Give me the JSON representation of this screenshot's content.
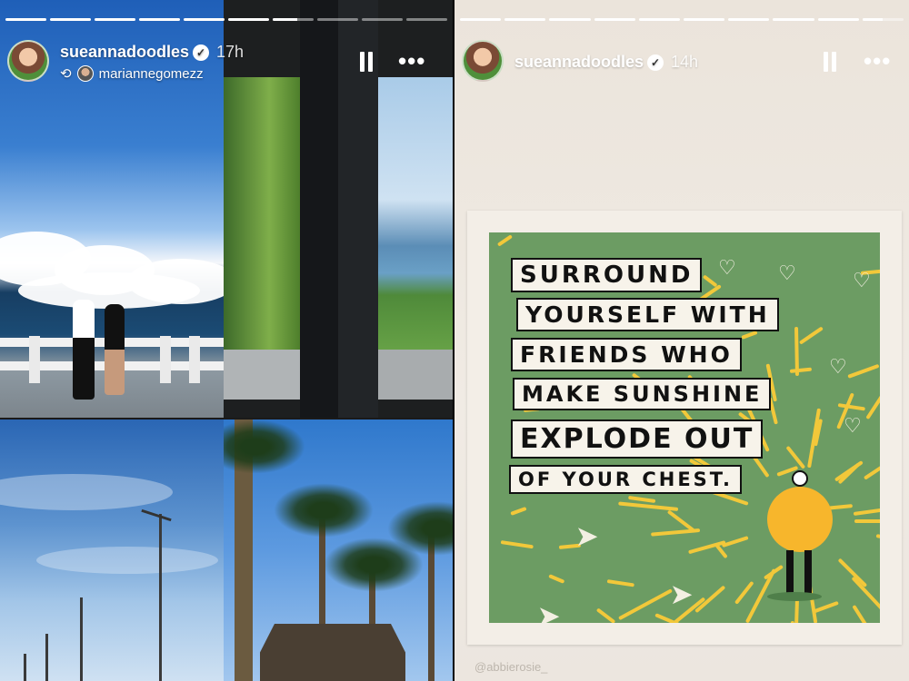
{
  "left_story": {
    "progress": [
      1,
      1,
      1,
      1,
      1,
      1,
      0.6,
      0,
      0,
      0
    ],
    "username": "sueannadoodles",
    "time": "17h",
    "reposted_from": "mariannegomezz",
    "icons": {
      "verified": "verified-badge-icon",
      "repost": "repost-icon",
      "pause": "pause-icon",
      "more": "more-options-icon"
    }
  },
  "right_story": {
    "progress": [
      1,
      1,
      1,
      1,
      1,
      1,
      1,
      1,
      1,
      0.5
    ],
    "username": "sueannadoodles",
    "time": "14h",
    "poster": {
      "lines": [
        "SURROUND",
        "YOURSELF WITH",
        "FRIENDS WHO",
        "MAKE SUNSHINE",
        "EXPLODE OUT",
        "OF YOUR CHEST."
      ]
    },
    "credit": "@abbierosie_"
  },
  "colors": {
    "poster_green": "#6c9c63",
    "ray_yellow": "#f2c83a",
    "sun_orange": "#f7b62c"
  }
}
